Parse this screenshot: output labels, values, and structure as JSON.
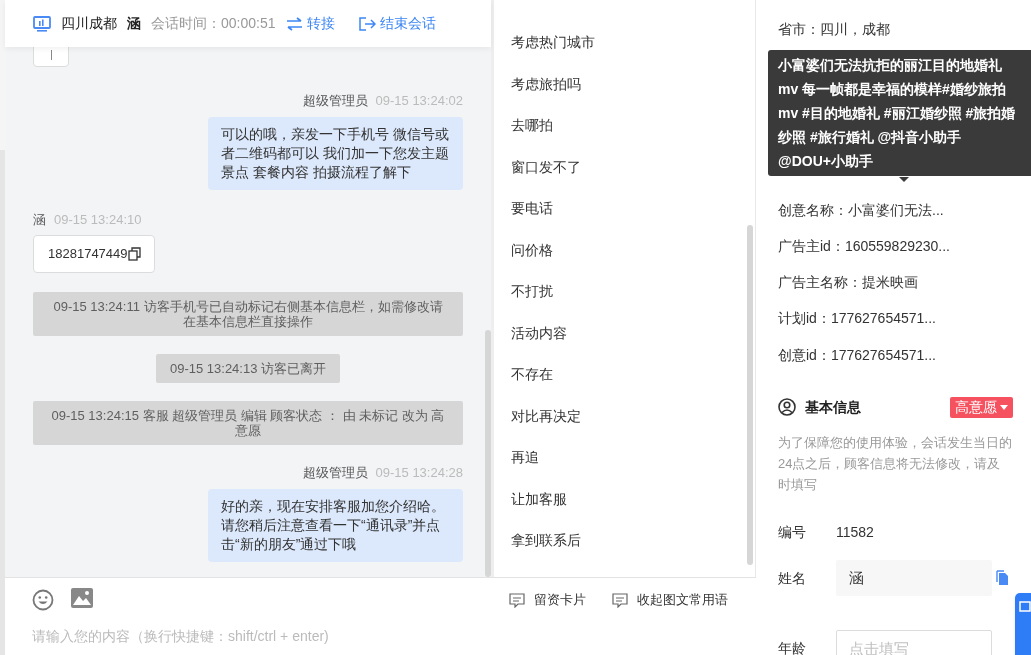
{
  "header": {
    "title": "四川成都",
    "visitor": "涵",
    "timer": "会话时间：00:00:51",
    "actions": [
      {
        "label": "转接",
        "kind": "transfer"
      },
      {
        "label": "结束会话",
        "kind": "end"
      }
    ]
  },
  "messages": [
    {
      "kind": "agent",
      "sender": "超级管理员",
      "time": "09-15 13:24:02",
      "text": "可以的哦，亲发一下手机号 微信号或者二维码都可以 我们加一下您发主题景点 套餐内容 拍摄流程了解下"
    },
    {
      "kind": "visitor",
      "sender": "涵",
      "time": "09-15 13:24:10",
      "text": "18281747449"
    },
    {
      "kind": "system",
      "text": "09-15 13:24:11 访客手机号已自动标记右侧基本信息栏，如需修改请在基本信息栏直接操作"
    },
    {
      "kind": "system",
      "text": "09-15 13:24:13 访客已离开"
    },
    {
      "kind": "system",
      "text": "09-15 13:24:15 客服 超级管理员 编辑 顾客状态 ： 由 未标记 改为 高意愿"
    },
    {
      "kind": "agent",
      "sender": "超级管理员",
      "time": "09-15 13:24:28",
      "text": "好的亲，现在安排客服加您介绍哈。请您稍后注意查看一下“通讯录”并点击“新的朋友”通过下哦"
    }
  ],
  "composer": {
    "actions": [
      "留资卡片",
      "收起图文常用语"
    ],
    "placeholder": "请输入您的内容（换行快捷键：shift/ctrl + enter)"
  },
  "phrases": [
    "考虑热门城市",
    "考虑旅拍吗",
    "去哪拍",
    "窗口发不了",
    "要电话",
    "问价格",
    "不打扰",
    "活动内容",
    "不存在",
    "对比再决定",
    "再追",
    "让加客服",
    "拿到联系后"
  ],
  "visit_info": [
    "省市：四川，成都",
    "创意名称：小富婆们无法...",
    "广告主id：160559829230...",
    "广告主名称：提米映画",
    "计划id：177627654571...",
    "创意id：177627654571..."
  ],
  "tooltip": "小富婆们无法抗拒的丽江目的地婚礼mv 每一帧都是幸福的模样#婚纱旅拍mv #目的地婚礼 #丽江婚纱照 #旅拍婚纱照 #旅行婚礼 @抖音小助手 @DOU+小助手",
  "basic_info": {
    "title": "基本信息",
    "status": {
      "label": "高意愿",
      "color": "#f5515f"
    },
    "notice": "为了保障您的使用体验，会话发生当日的24点之后，顾客信息将无法修改，请及时填写",
    "fields": [
      {
        "kind": "text",
        "label": "编号",
        "value": "11582"
      },
      {
        "kind": "filled",
        "label": "姓名",
        "value": "涵"
      },
      {
        "kind": "input",
        "label": "年龄",
        "placeholder": "点击填写"
      }
    ]
  }
}
